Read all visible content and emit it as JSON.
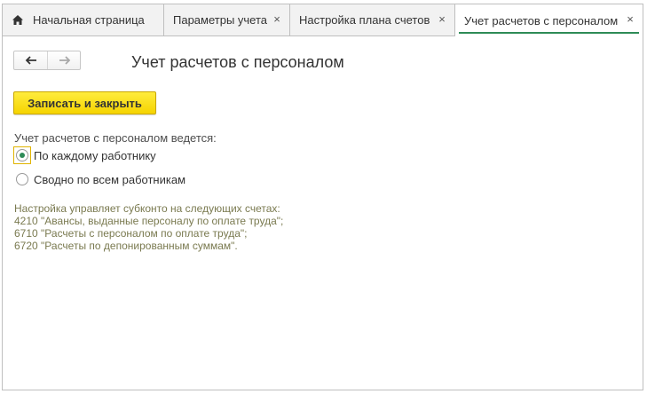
{
  "tabs": [
    {
      "label": "Начальная страница",
      "icon": "home-icon"
    },
    {
      "label": "Параметры учета",
      "closable": true
    },
    {
      "label": "Настройка плана счетов",
      "closable": true
    },
    {
      "label": "Учет расчетов с персоналом",
      "closable": true,
      "active": true
    }
  ],
  "tab_close_glyph": "×",
  "nav": {
    "back_icon": "arrow-left-icon",
    "forward_icon": "arrow-right-icon"
  },
  "page": {
    "title": "Учет расчетов с персоналом",
    "save_button": "Записать и закрыть"
  },
  "form": {
    "group_label": "Учет расчетов с персоналом ведется:",
    "options": [
      {
        "label": "По каждому работнику",
        "selected": true
      },
      {
        "label": "Сводно по всем работникам",
        "selected": false
      }
    ]
  },
  "note": {
    "lines": [
      "Настройка управляет субконто на следующих счетах:",
      "4210 \"Авансы, выданные персоналу по оплате труда\";",
      "6710 \"Расчеты с персоналом по оплате труда\";",
      "6720 \"Расчеты по депонированным суммам\"."
    ]
  },
  "colors": {
    "accent": "#2e8b57",
    "save_button_bg": "#f5d400",
    "note_text": "#7a7a50"
  }
}
